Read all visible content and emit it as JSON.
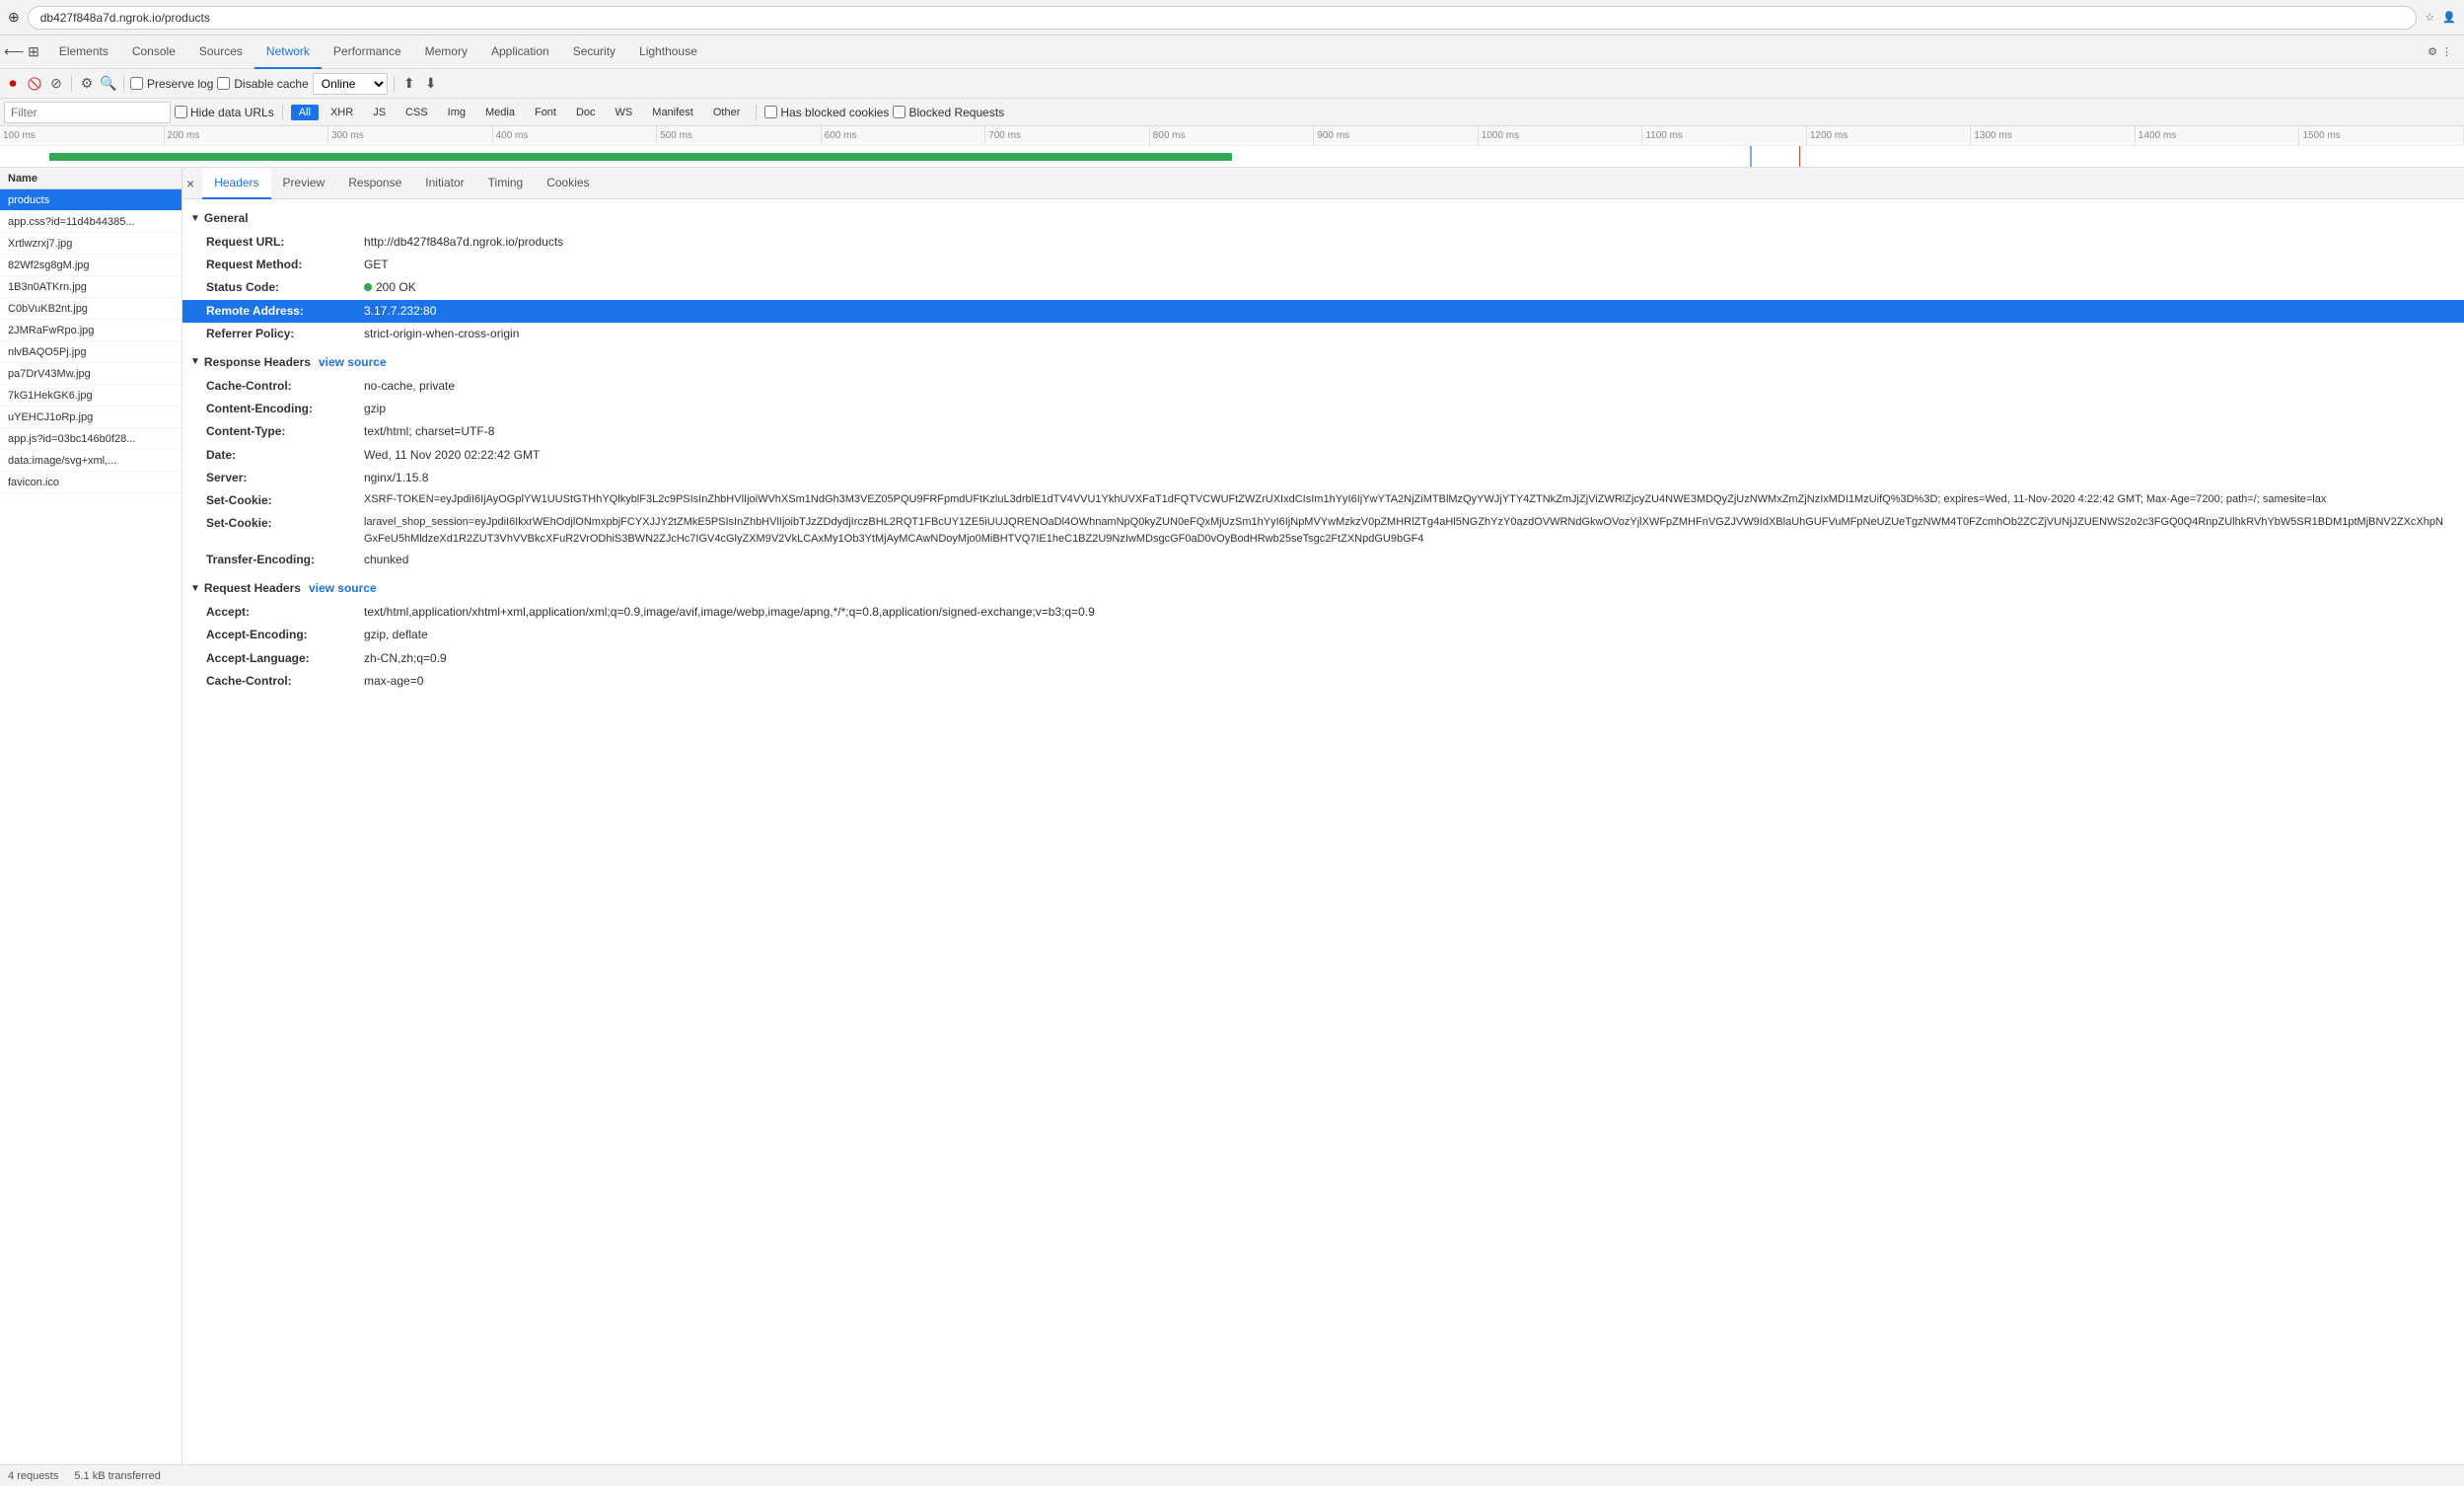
{
  "browser": {
    "address": "db427f848a7d.ngrok.io/products",
    "favicon": "⊕"
  },
  "devtools": {
    "tabs": [
      "Elements",
      "Console",
      "Sources",
      "Network",
      "Performance",
      "Memory",
      "Application",
      "Security",
      "Lighthouse"
    ],
    "active_tab": "Network"
  },
  "network_toolbar": {
    "preserve_log": "Preserve log",
    "disable_cache": "Disable cache",
    "online": "Online",
    "filter_placeholder": "Filter"
  },
  "filter_types": {
    "hide_data_urls": "Hide data URLs",
    "all": "All",
    "xhr": "XHR",
    "js": "JS",
    "css": "CSS",
    "img": "Img",
    "media": "Media",
    "font": "Font",
    "doc": "Doc",
    "ws": "WS",
    "manifest": "Manifest",
    "other": "Other",
    "has_blocked_cookies": "Has blocked cookies",
    "blocked_requests": "Blocked Requests"
  },
  "timeline": {
    "labels": [
      "100 ms",
      "200 ms",
      "300 ms",
      "400 ms",
      "500 ms",
      "600 ms",
      "700 ms",
      "800 ms",
      "900 ms",
      "1000 ms",
      "1100 ms",
      "1200 ms",
      "1300 ms",
      "1400 ms",
      "1500 ms"
    ]
  },
  "file_list": {
    "column_name": "Name",
    "items": [
      {
        "name": "products",
        "active": true
      },
      {
        "name": "app.css?id=11d4b44385...",
        "active": false
      },
      {
        "name": "Xrtlwzrxj7.jpg",
        "active": false
      },
      {
        "name": "82Wf2sg8gM.jpg",
        "active": false
      },
      {
        "name": "1B3n0ATKrn.jpg",
        "active": false
      },
      {
        "name": "C0bVuKB2nt.jpg",
        "active": false
      },
      {
        "name": "2JMRaFwRpo.jpg",
        "active": false
      },
      {
        "name": "nlvBAQO5Pj.jpg",
        "active": false
      },
      {
        "name": "pa7DrV43Mw.jpg",
        "active": false
      },
      {
        "name": "7kG1HekGK6.jpg",
        "active": false
      },
      {
        "name": "uYEHCJ1oRp.jpg",
        "active": false
      },
      {
        "name": "app.js?id=03bc146b0f28...",
        "active": false
      },
      {
        "name": "data:image/svg+xml,...",
        "active": false
      },
      {
        "name": "favicon.ico",
        "active": false
      }
    ]
  },
  "request_tabs": {
    "close_label": "×",
    "tabs": [
      "Headers",
      "Preview",
      "Response",
      "Initiator",
      "Timing",
      "Cookies"
    ],
    "active_tab": "Headers"
  },
  "general_section": {
    "title": "General",
    "fields": [
      {
        "name": "Request URL:",
        "value": "http://db427f848a7d.ngrok.io/products",
        "highlighted": false
      },
      {
        "name": "Request Method:",
        "value": "GET",
        "highlighted": false
      },
      {
        "name": "Status Code:",
        "value": "200  OK",
        "has_dot": true,
        "highlighted": false
      },
      {
        "name": "Remote Address:",
        "value": "3.17.7.232:80",
        "highlighted": true
      },
      {
        "name": "Referrer Policy:",
        "value": "strict-origin-when-cross-origin",
        "highlighted": false
      }
    ]
  },
  "response_headers_section": {
    "title": "Response Headers",
    "view_source": "view source",
    "fields": [
      {
        "name": "Cache-Control:",
        "value": "no-cache, private"
      },
      {
        "name": "Content-Encoding:",
        "value": "gzip"
      },
      {
        "name": "Content-Type:",
        "value": "text/html; charset=UTF-8"
      },
      {
        "name": "Date:",
        "value": "Wed, 11 Nov 2020 02:22:42 GMT"
      },
      {
        "name": "Server:",
        "value": "nginx/1.15.8"
      },
      {
        "name": "Set-Cookie:",
        "value": "XSRF-TOKEN=eyJpdiI6IjAyOGplYW1UUStGTHhYQlkyblF3L2c9PSIsInZhbHVlIjoiWVhXSm1NdGh3M3VEZ05PQU9FRFpmdUFtKzluL3drblE1dTV4VVU1YkhUVXFaT1dFQTVCWUFtZWZrUXIxdCIsIm1hYyI6IjYwYTA2NjZiMTBlMzQyYWJjYTY4ZTNkZmJjZjViZWRlZjcyZU4NWE3MDQyZjUzNWMxZmZjNzIxMDI1MzUifQ%3D%3D; expires=Wed, 11-Nov-2020 4:22:42 GMT; Max-Age=7200; path=/; samesite=lax"
      },
      {
        "name": "Set-Cookie:",
        "value": "laravel_shop_session=eyJpdiI6IkxrWEhOdjlONmxpbjFCYXJJY2tZMkE9PSIsInZhbHVlIjoibTJzZDdydjIrczBHL2RQT1FBcUY1ZE5iUUJQRENOaDl4OWhnamNpQ0kyZUN0eFQxMjUzSm1hYyI6IjNpMVYwMzkzV0pZMHRlZTg4aHl5NGZhYzY0azdOVWRNdGkwOVozYjlXWFpZMHFnVGZJVW9IdXBlaUhGUFVuMFpNeUZUeTgzNWM4T0FZcmhOb2ZCZjVUNjJZUENWS2o2c3FGQ0Q4RnpZUlhkRVhYbW5SR1BDM1ptMjBNV2ZXcXhpNGxFeU5hMldzeXd1R2ZUT3VhVVBkcXFuR2VrODhiS3BWN2ZJcHc7IGV4cGlyZXM9V2VkLCAxMy1Ob3YtMjAyMCAwNDoyMjo0MiBHTVQ7IE1heC1BZ2U9NzIwMDsgcGF0aD0vOyBodHRwb25seTsgc2FtZXNpdGU9bGF4"
      },
      {
        "name": "Transfer-Encoding:",
        "value": "chunked"
      }
    ]
  },
  "request_headers_section": {
    "title": "Request Headers",
    "view_source": "view source",
    "fields": [
      {
        "name": "Accept:",
        "value": "text/html,application/xhtml+xml,application/xml;q=0.9,image/avif,image/webp,image/apng,*/*;q=0.8,application/signed-exchange;v=b3;q=0.9"
      },
      {
        "name": "Accept-Encoding:",
        "value": "gzip, deflate"
      },
      {
        "name": "Accept-Language:",
        "value": "zh-CN,zh;q=0.9"
      },
      {
        "name": "Cache-Control:",
        "value": "max-age=0"
      }
    ]
  },
  "status_bar": {
    "requests": "4 requests",
    "transferred": "5.1 kB transferred"
  }
}
